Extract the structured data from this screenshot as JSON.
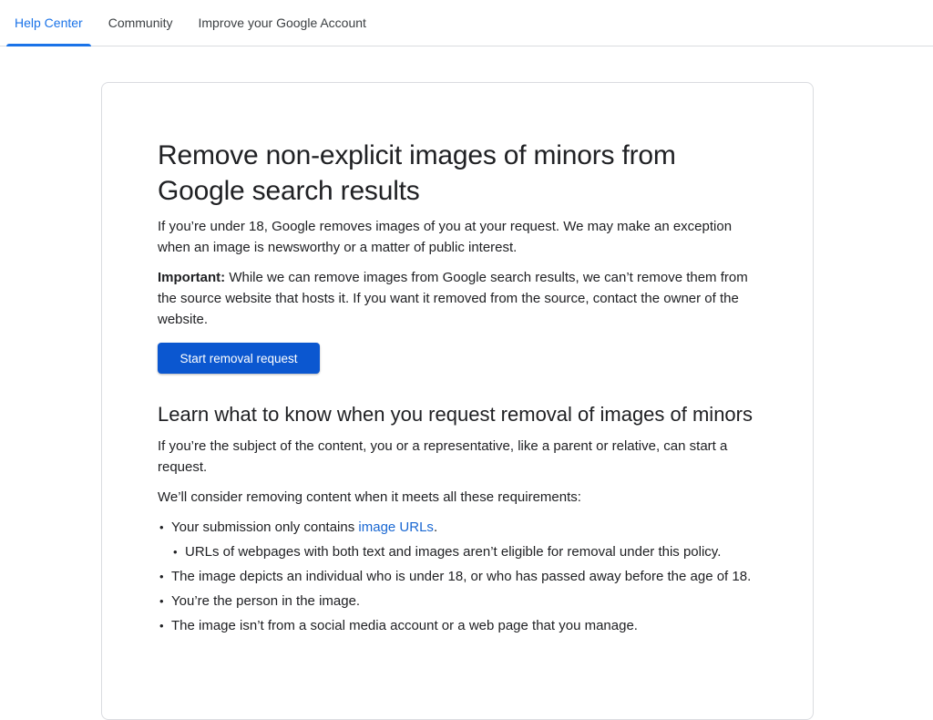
{
  "nav": {
    "tabs": [
      {
        "label": "Help Center",
        "active": true
      },
      {
        "label": "Community",
        "active": false
      },
      {
        "label": "Improve your Google Account",
        "active": false
      }
    ]
  },
  "article": {
    "title": "Remove non-explicit images of minors from Google search results",
    "intro": "If you’re under 18, Google removes images of you at your request. We may make an exception when an image is newsworthy or a matter of public interest.",
    "important_label": "Important:",
    "important_text": " While we can remove images from Google search results, we can’t remove them from the source website that hosts it. If you want it removed from the source, contact the owner of the website.",
    "button_label": "Start removal request",
    "section_title": "Learn what to know when you request removal of images of minors",
    "section_p1": "If you’re the subject of the content, you or a representative, like a parent or relative, can start a request.",
    "section_p2": "We’ll consider removing content when it meets all these requirements:",
    "req1_prefix": "Your submission only contains ",
    "req1_link": "image URLs",
    "req1_suffix": ".",
    "req1_sub": "URLs of webpages with both text and images aren’t eligible for removal under this policy.",
    "req2": "The image depicts an individual who is under 18, or who has passed away before the age of 18.",
    "req3": "You’re the person in the image.",
    "req4": "The image isn’t from a social media account or a web page that you manage."
  },
  "colors": {
    "accent": "#1a73e8",
    "button": "#0b57d0",
    "link": "#1967d2"
  }
}
